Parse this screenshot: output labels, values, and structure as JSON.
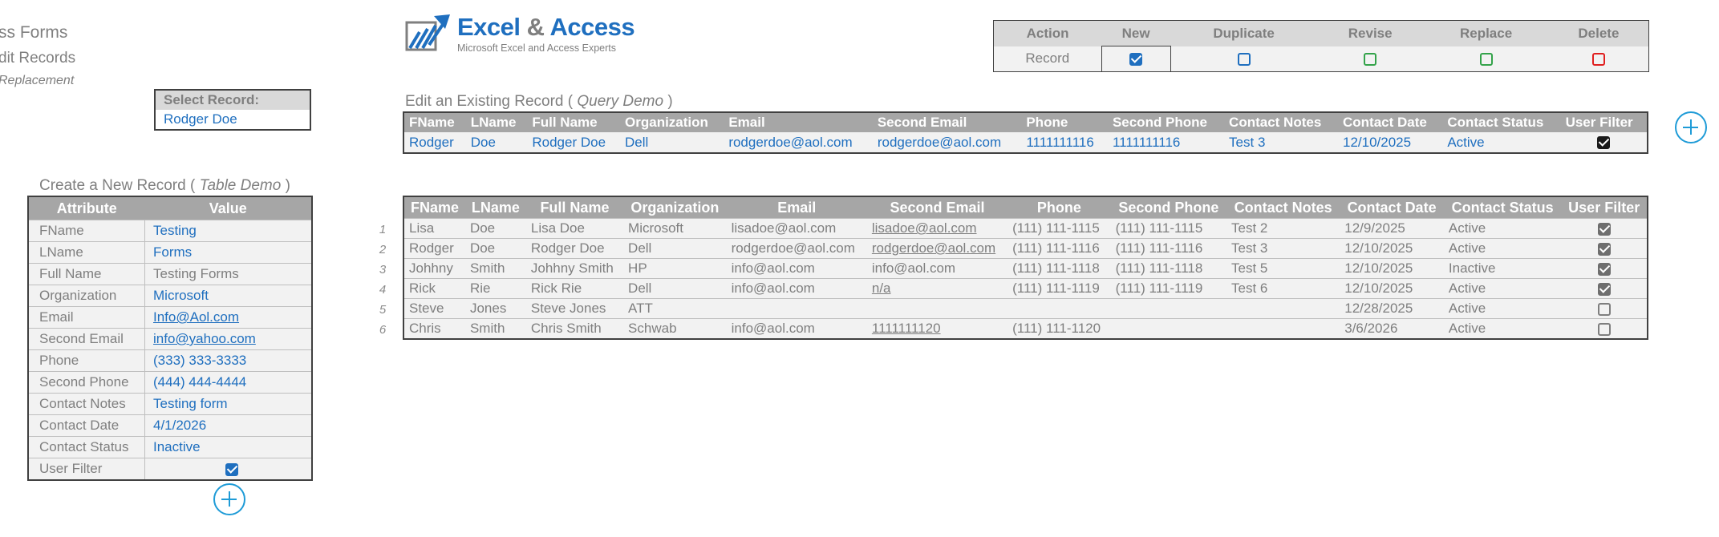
{
  "titles": {
    "t1": "ss Forms",
    "t2": "dit Records",
    "t3": "Replacement"
  },
  "logo": {
    "word1": "Excel",
    "amp": "&",
    "word2": "Access",
    "tagline": "Microsoft Excel and Access Experts"
  },
  "action_table": {
    "headers": [
      "Action",
      "New",
      "Duplicate",
      "Revise",
      "Replace",
      "Delete"
    ],
    "row_label": "Record",
    "checks": [
      {
        "name": "new",
        "checked": true,
        "color": "#1f6fbf"
      },
      {
        "name": "duplicate",
        "checked": false,
        "color": "#1f6fbf"
      },
      {
        "name": "revise",
        "checked": false,
        "color": "#33a34a"
      },
      {
        "name": "replace",
        "checked": false,
        "color": "#33a34a"
      },
      {
        "name": "delete",
        "checked": false,
        "color": "#e02020"
      }
    ]
  },
  "select_record": {
    "label": "Select Record:",
    "value": "Rodger Doe"
  },
  "edit_section": {
    "label_prefix": "Edit an Existing Record (",
    "label_italic": "Query Demo",
    "label_suffix": ")",
    "headers": [
      "FName",
      "LName",
      "Full Name",
      "Organization",
      "Email",
      "Second Email",
      "Phone",
      "Second Phone",
      "Contact Notes",
      "Contact Date",
      "Contact Status",
      "User Filter"
    ],
    "row": [
      "Rodger",
      "Doe",
      "Rodger Doe",
      "Dell",
      "rodgerdoe@aol.com",
      "rodgerdoe@aol.com",
      "1111111116",
      "1111111116",
      "Test 3",
      "12/10/2025",
      "Active"
    ],
    "user_filter": true
  },
  "data_table": {
    "headers": [
      "FName",
      "LName",
      "Full Name",
      "Organization",
      "Email",
      "Second Email",
      "Phone",
      "Second Phone",
      "Contact Notes",
      "Contact Date",
      "Contact Status",
      "User Filter"
    ],
    "row_numbers": [
      "1",
      "2",
      "3",
      "4",
      "5",
      "6"
    ],
    "rows": [
      [
        "Lisa",
        "Doe",
        "Lisa Doe",
        "Microsoft",
        "lisadoe@aol.com",
        "lisadoe@aol.com",
        "(111) 111-1115",
        "(111) 111-1115",
        "Test 2",
        "12/9/2025",
        "Active"
      ],
      [
        "Rodger",
        "Doe",
        "Rodger Doe",
        "Dell",
        "rodgerdoe@aol.com",
        "rodgerdoe@aol.com",
        "(111) 111-1116",
        "(111) 111-1116",
        "Test 3",
        "12/10/2025",
        "Active"
      ],
      [
        "Johhny",
        "Smith",
        "Johhny Smith",
        "HP",
        "info@aol.com",
        "info@aol.com",
        "(111) 111-1118",
        "(111) 111-1118",
        "Test 5",
        "12/10/2025",
        "Inactive"
      ],
      [
        "Rick",
        "Rie",
        "Rick Rie",
        "Dell",
        "info@aol.com",
        "n/a",
        "(111) 111-1119",
        "(111) 111-1119",
        "Test 6",
        "12/10/2025",
        "Active"
      ],
      [
        "Steve",
        "Jones",
        "Steve Jones",
        "ATT",
        "",
        "",
        "",
        "",
        "",
        "12/28/2025",
        "Active"
      ],
      [
        "Chris",
        "Smith",
        "Chris Smith",
        "Schwab",
        "info@aol.com",
        "1111111120",
        "(111) 111-1120",
        "",
        "",
        "3/6/2026",
        "Active"
      ]
    ],
    "user_filter": [
      true,
      true,
      true,
      true,
      false,
      false
    ],
    "underlined_second_email": [
      true,
      true,
      false,
      true,
      false,
      true
    ]
  },
  "create_section": {
    "label_prefix": "Create a New Record (",
    "label_italic": "Table Demo",
    "label_suffix": ")",
    "headers": [
      "Attribute",
      "Value"
    ],
    "rows": [
      {
        "attr": "FName",
        "value": "Testing"
      },
      {
        "attr": "LName",
        "value": "Forms"
      },
      {
        "attr": "Full Name",
        "value": "Testing Forms"
      },
      {
        "attr": "Organization",
        "value": "Microsoft"
      },
      {
        "attr": "Email",
        "value": "Info@Aol.com"
      },
      {
        "attr": "Second Email",
        "value": "info@yahoo.com"
      },
      {
        "attr": "Phone",
        "value": "(333) 333-3333"
      },
      {
        "attr": "Second Phone",
        "value": "(444) 444-4444"
      },
      {
        "attr": "Contact Notes",
        "value": "Testing form"
      },
      {
        "attr": "Contact Date",
        "value": "4/1/2026"
      },
      {
        "attr": "Contact Status",
        "value": "Inactive"
      },
      {
        "attr": "User Filter",
        "value": ""
      }
    ],
    "user_filter": true
  },
  "colors": {
    "accent_blue": "#1f6fbf",
    "plus_blue": "#1e9bd7",
    "header_gray": "#a6a6a6"
  },
  "icons": {
    "add_top": "plus-circle-icon",
    "add_bottom": "plus-circle-icon"
  }
}
